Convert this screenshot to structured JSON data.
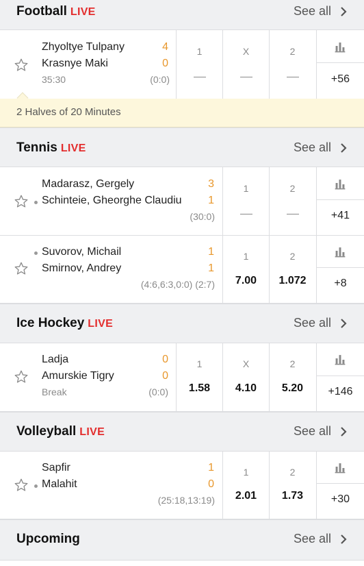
{
  "sections": {
    "football": {
      "title": "Football",
      "live": "LIVE",
      "see_all": "See all"
    },
    "tennis": {
      "title": "Tennis",
      "live": "LIVE",
      "see_all": "See all"
    },
    "ice_hockey": {
      "title": "Ice Hockey",
      "live": "LIVE",
      "see_all": "See all"
    },
    "volleyball": {
      "title": "Volleyball",
      "live": "LIVE",
      "see_all": "See all"
    },
    "upcoming": {
      "title": "Upcoming",
      "see_all": "See all"
    }
  },
  "colors": {
    "live": "#e32d2d",
    "score": "#e8972c",
    "info_bg": "#fdf7dc"
  },
  "matches": [
    {
      "team1": "Zhyoltye Tulpany",
      "score1": "4",
      "team2": "Krasnye Maki",
      "score2": "0",
      "time": "35:30",
      "extra": "(0:0)",
      "odds": [
        {
          "label": "1",
          "value": "—"
        },
        {
          "label": "X",
          "value": "—"
        },
        {
          "label": "2",
          "value": "—"
        }
      ],
      "more": "+56",
      "info": "2 Halves of 20 Minutes"
    },
    {
      "team1": "Madarasz, Gergely",
      "score1": "3",
      "team2": "Schinteie, Gheorghe Claudiu",
      "score2": "1",
      "extra": "(30:0)",
      "odds": [
        {
          "label": "1",
          "value": "—"
        },
        {
          "label": "2",
          "value": "—"
        }
      ],
      "more": "+41"
    },
    {
      "team1": "Suvorov, Michail",
      "score1": "1",
      "team2": "Smirnov, Andrey",
      "score2": "1",
      "extra": "(4:6,6:3,0:0) (2:7)",
      "odds": [
        {
          "label": "1",
          "value": "7.00"
        },
        {
          "label": "2",
          "value": "1.072"
        }
      ],
      "more": "+8"
    },
    {
      "team1": "Ladja",
      "score1": "0",
      "team2": "Amurskie Tigry",
      "score2": "0",
      "time": "Break",
      "extra": "(0:0)",
      "odds": [
        {
          "label": "1",
          "value": "1.58"
        },
        {
          "label": "X",
          "value": "4.10"
        },
        {
          "label": "2",
          "value": "5.20"
        }
      ],
      "more": "+146"
    },
    {
      "team1": "Sapfir",
      "score1": "1",
      "team2": "Malahit",
      "score2": "0",
      "extra": "(25:18,13:19)",
      "odds": [
        {
          "label": "1",
          "value": "2.01"
        },
        {
          "label": "2",
          "value": "1.73"
        }
      ],
      "more": "+30"
    }
  ]
}
